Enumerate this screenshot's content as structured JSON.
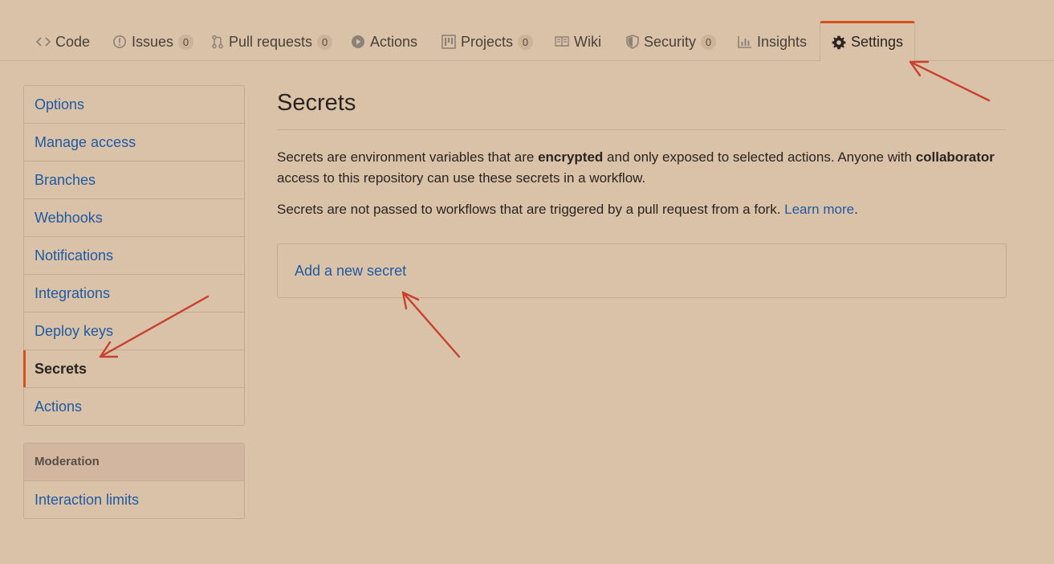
{
  "tabs": [
    {
      "label": "Code",
      "icon": "code-icon"
    },
    {
      "label": "Issues",
      "icon": "issue-icon",
      "count": "0"
    },
    {
      "label": "Pull requests",
      "icon": "pull-request-icon",
      "count": "0"
    },
    {
      "label": "Actions",
      "icon": "play-icon"
    },
    {
      "label": "Projects",
      "icon": "project-icon",
      "count": "0"
    },
    {
      "label": "Wiki",
      "icon": "book-icon"
    },
    {
      "label": "Security",
      "icon": "shield-icon",
      "count": "0"
    },
    {
      "label": "Insights",
      "icon": "graph-icon"
    },
    {
      "label": "Settings",
      "icon": "gear-icon",
      "selected": true
    }
  ],
  "sidebar": {
    "items": [
      {
        "label": "Options"
      },
      {
        "label": "Manage access"
      },
      {
        "label": "Branches"
      },
      {
        "label": "Webhooks"
      },
      {
        "label": "Notifications"
      },
      {
        "label": "Integrations"
      },
      {
        "label": "Deploy keys"
      },
      {
        "label": "Secrets",
        "selected": true
      },
      {
        "label": "Actions"
      }
    ],
    "moderation": {
      "heading": "Moderation",
      "items": [
        {
          "label": "Interaction limits"
        }
      ]
    }
  },
  "main": {
    "title": "Secrets",
    "intro": {
      "part1": "Secrets are environment variables that are ",
      "bold1": "encrypted",
      "part2": " and only exposed to selected actions. Anyone with ",
      "bold2": "collaborator",
      "part3": " access to this repository can use these secrets in a workflow."
    },
    "fork_note": {
      "text": "Secrets are not passed to workflows that are triggered by a pull request from a fork. ",
      "link": "Learn more",
      "suffix": "."
    },
    "add_secret_link": "Add a new secret"
  },
  "colors": {
    "background": "#dac2a9",
    "accent": "#d1541c",
    "link": "#1f5aa3",
    "annotation_arrow": "#c8402f"
  }
}
